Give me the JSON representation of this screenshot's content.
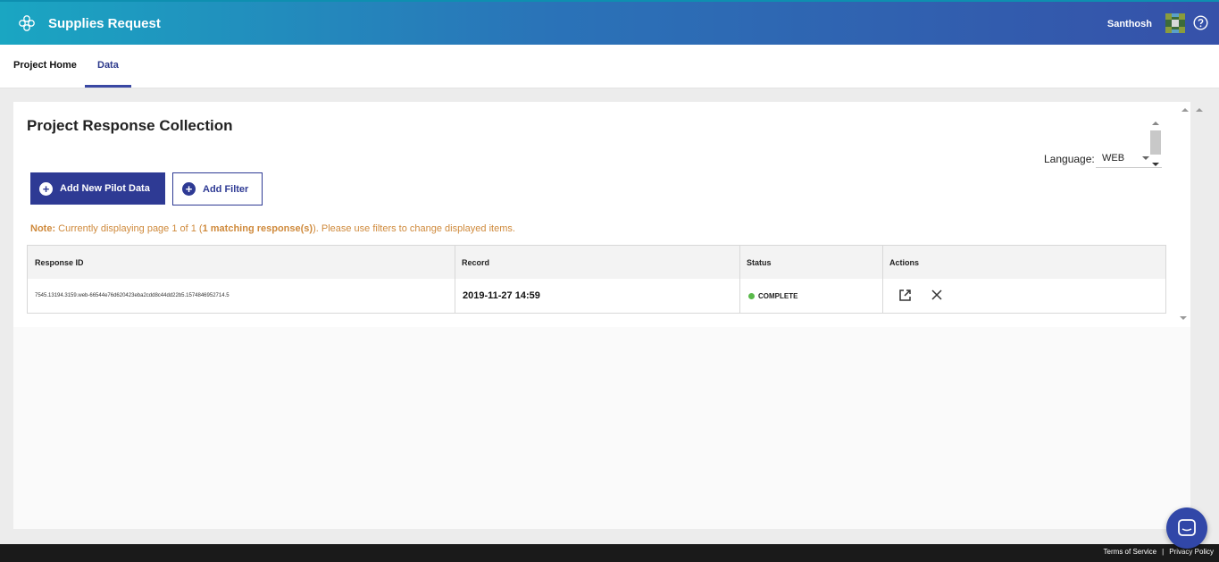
{
  "header": {
    "app_title": "Supplies Request",
    "user_name": "Santhosh",
    "logo_icon": "flower-logo-icon",
    "help_icon": "help-circle-icon"
  },
  "nav": {
    "tabs": [
      {
        "label": "Project Home",
        "active": false
      },
      {
        "label": "Data",
        "active": true
      }
    ]
  },
  "main": {
    "title": "Project Response Collection",
    "language_label": "Language:",
    "language_value": "WEB",
    "add_pilot_label": "Add New Pilot Data",
    "add_filter_label": "Add Filter",
    "note": {
      "prefix": "Note:",
      "text_before": " Currently displaying page 1 of 1 (",
      "bold": "1 matching response(s)",
      "text_after": "). Please use filters to change displayed items."
    },
    "table": {
      "headers": [
        "Response ID",
        "Record",
        "Status",
        "Actions"
      ],
      "rows": [
        {
          "response_id": "7545.13194.3159.web-66544e76d620423eba2cdd8c44dd22b5.1574846952714.5",
          "record": "2019-11-27 14:59",
          "status": "COMPLETE"
        }
      ]
    }
  },
  "footer": {
    "terms": "Terms of Service",
    "separator": "|",
    "privacy": "Privacy Policy"
  },
  "colors": {
    "primary": "#2e3a94",
    "note": "#cf8a3c",
    "status_complete": "#59b94a"
  }
}
